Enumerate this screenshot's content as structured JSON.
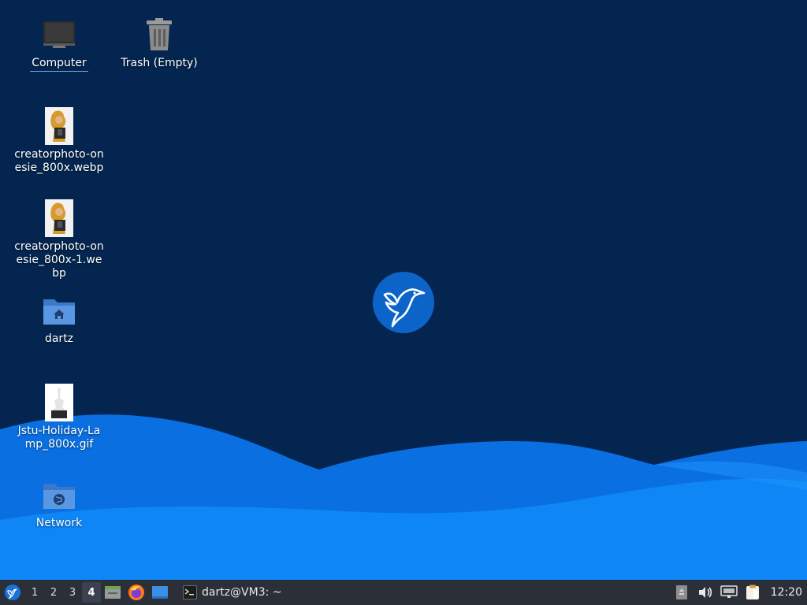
{
  "desktop": {
    "icons": {
      "computer": {
        "label": "Computer",
        "icon": "computer-icon"
      },
      "trash": {
        "label": "Trash (Empty)",
        "icon": "trash-icon"
      },
      "photo1": {
        "label": "creatorphoto-onesie_800x.webp",
        "icon": "image-thumbnail-icon"
      },
      "photo2": {
        "label": "creatorphoto-onesie_800x-1.webp",
        "icon": "image-thumbnail-icon"
      },
      "home": {
        "label": "dartz",
        "icon": "home-folder-icon"
      },
      "gif": {
        "label": "Jstu-Holiday-Lamp_800x.gif",
        "icon": "image-thumbnail-icon"
      },
      "network": {
        "label": "Network",
        "icon": "network-folder-icon"
      }
    },
    "colors": {
      "background": "#03254f",
      "wave_light": "#0f86f5",
      "wave_mid": "#0a6fe0",
      "logo_blue": "#0c64c8"
    }
  },
  "taskbar": {
    "workspaces": [
      "1",
      "2",
      "3",
      "4"
    ],
    "active_workspace": "4",
    "launchers": [
      "file-manager-icon",
      "firefox-icon",
      "show-desktop-icon"
    ],
    "task": {
      "label": "dartz@VM3: ~",
      "icon": "terminal-icon"
    },
    "tray": [
      "removable-drive-icon",
      "volume-icon",
      "network-icon",
      "clipboard-icon"
    ],
    "clock": "12:20"
  }
}
